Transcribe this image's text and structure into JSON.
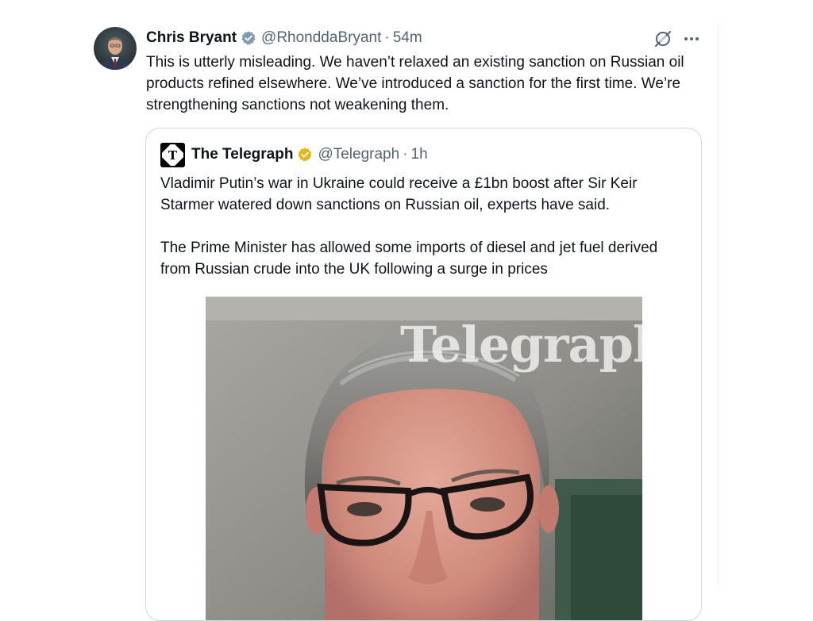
{
  "post": {
    "author_name": "Chris Bryant",
    "author_handle": "@RhonddaBryant",
    "time_separator": "·",
    "time": "54m",
    "text": "This is utterly misleading. We haven’t relaxed an existing sanction on Russian oil products refined elsewhere. We’ve introduced a sanction for the first time. We’re strengthening sanctions not weakening them.",
    "verified_badge_color": "#829aab"
  },
  "quote": {
    "author_name": "The Telegraph",
    "author_handle": "@Telegraph",
    "time_separator": "·",
    "time": "1h",
    "verified_badge_color": "#e2b719",
    "paragraphs": [
      "Vladimir Putin’s war in Ukraine could receive a £1bn boost after Sir Keir Starmer watered down sanctions on Russian oil, experts have said.",
      "The Prime Minister has allowed some imports of diesel and jet fuel derived from Russian crude into the UK following a surge in prices"
    ],
    "image_watermark": "Telegraph"
  },
  "icons": {
    "grok": "grok-icon",
    "more": "more-options-icon",
    "verified": "verified-badge-icon",
    "publisher_logo": "telegraph-logo-icon"
  }
}
